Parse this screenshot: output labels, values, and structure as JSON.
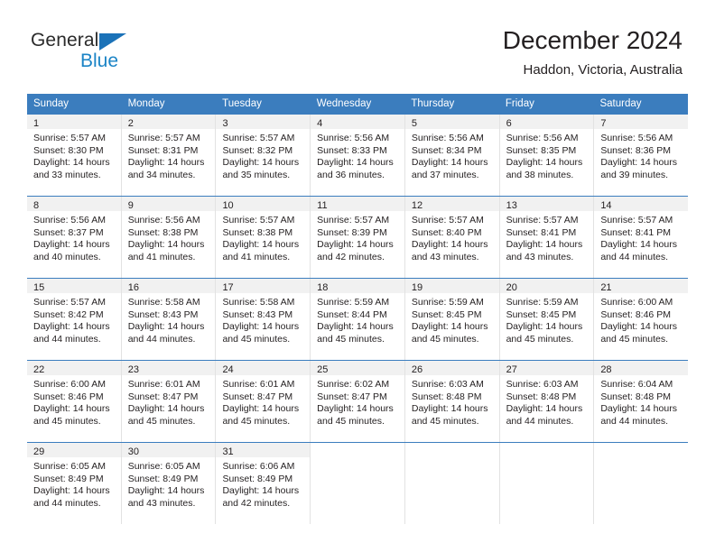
{
  "brand": {
    "name_top": "General",
    "name_bottom": "Blue",
    "triangle_color": "#1b72b8",
    "blue_text_color": "#1b84c6"
  },
  "header": {
    "title": "December 2024",
    "subtitle": "Haddon, Victoria, Australia"
  },
  "theme": {
    "header_blue": "#3b7dbe",
    "daynum_background": "#f1f1f1",
    "text_color": "#231f20",
    "cell_divider": "#e2e2e2"
  },
  "weekdays": [
    "Sunday",
    "Monday",
    "Tuesday",
    "Wednesday",
    "Thursday",
    "Friday",
    "Saturday"
  ],
  "weeks": [
    [
      {
        "day": "1",
        "sunrise": "Sunrise: 5:57 AM",
        "sunset": "Sunset: 8:30 PM",
        "daylight1": "Daylight: 14 hours",
        "daylight2": "and 33 minutes."
      },
      {
        "day": "2",
        "sunrise": "Sunrise: 5:57 AM",
        "sunset": "Sunset: 8:31 PM",
        "daylight1": "Daylight: 14 hours",
        "daylight2": "and 34 minutes."
      },
      {
        "day": "3",
        "sunrise": "Sunrise: 5:57 AM",
        "sunset": "Sunset: 8:32 PM",
        "daylight1": "Daylight: 14 hours",
        "daylight2": "and 35 minutes."
      },
      {
        "day": "4",
        "sunrise": "Sunrise: 5:56 AM",
        "sunset": "Sunset: 8:33 PM",
        "daylight1": "Daylight: 14 hours",
        "daylight2": "and 36 minutes."
      },
      {
        "day": "5",
        "sunrise": "Sunrise: 5:56 AM",
        "sunset": "Sunset: 8:34 PM",
        "daylight1": "Daylight: 14 hours",
        "daylight2": "and 37 minutes."
      },
      {
        "day": "6",
        "sunrise": "Sunrise: 5:56 AM",
        "sunset": "Sunset: 8:35 PM",
        "daylight1": "Daylight: 14 hours",
        "daylight2": "and 38 minutes."
      },
      {
        "day": "7",
        "sunrise": "Sunrise: 5:56 AM",
        "sunset": "Sunset: 8:36 PM",
        "daylight1": "Daylight: 14 hours",
        "daylight2": "and 39 minutes."
      }
    ],
    [
      {
        "day": "8",
        "sunrise": "Sunrise: 5:56 AM",
        "sunset": "Sunset: 8:37 PM",
        "daylight1": "Daylight: 14 hours",
        "daylight2": "and 40 minutes."
      },
      {
        "day": "9",
        "sunrise": "Sunrise: 5:56 AM",
        "sunset": "Sunset: 8:38 PM",
        "daylight1": "Daylight: 14 hours",
        "daylight2": "and 41 minutes."
      },
      {
        "day": "10",
        "sunrise": "Sunrise: 5:57 AM",
        "sunset": "Sunset: 8:38 PM",
        "daylight1": "Daylight: 14 hours",
        "daylight2": "and 41 minutes."
      },
      {
        "day": "11",
        "sunrise": "Sunrise: 5:57 AM",
        "sunset": "Sunset: 8:39 PM",
        "daylight1": "Daylight: 14 hours",
        "daylight2": "and 42 minutes."
      },
      {
        "day": "12",
        "sunrise": "Sunrise: 5:57 AM",
        "sunset": "Sunset: 8:40 PM",
        "daylight1": "Daylight: 14 hours",
        "daylight2": "and 43 minutes."
      },
      {
        "day": "13",
        "sunrise": "Sunrise: 5:57 AM",
        "sunset": "Sunset: 8:41 PM",
        "daylight1": "Daylight: 14 hours",
        "daylight2": "and 43 minutes."
      },
      {
        "day": "14",
        "sunrise": "Sunrise: 5:57 AM",
        "sunset": "Sunset: 8:41 PM",
        "daylight1": "Daylight: 14 hours",
        "daylight2": "and 44 minutes."
      }
    ],
    [
      {
        "day": "15",
        "sunrise": "Sunrise: 5:57 AM",
        "sunset": "Sunset: 8:42 PM",
        "daylight1": "Daylight: 14 hours",
        "daylight2": "and 44 minutes."
      },
      {
        "day": "16",
        "sunrise": "Sunrise: 5:58 AM",
        "sunset": "Sunset: 8:43 PM",
        "daylight1": "Daylight: 14 hours",
        "daylight2": "and 44 minutes."
      },
      {
        "day": "17",
        "sunrise": "Sunrise: 5:58 AM",
        "sunset": "Sunset: 8:43 PM",
        "daylight1": "Daylight: 14 hours",
        "daylight2": "and 45 minutes."
      },
      {
        "day": "18",
        "sunrise": "Sunrise: 5:59 AM",
        "sunset": "Sunset: 8:44 PM",
        "daylight1": "Daylight: 14 hours",
        "daylight2": "and 45 minutes."
      },
      {
        "day": "19",
        "sunrise": "Sunrise: 5:59 AM",
        "sunset": "Sunset: 8:45 PM",
        "daylight1": "Daylight: 14 hours",
        "daylight2": "and 45 minutes."
      },
      {
        "day": "20",
        "sunrise": "Sunrise: 5:59 AM",
        "sunset": "Sunset: 8:45 PM",
        "daylight1": "Daylight: 14 hours",
        "daylight2": "and 45 minutes."
      },
      {
        "day": "21",
        "sunrise": "Sunrise: 6:00 AM",
        "sunset": "Sunset: 8:46 PM",
        "daylight1": "Daylight: 14 hours",
        "daylight2": "and 45 minutes."
      }
    ],
    [
      {
        "day": "22",
        "sunrise": "Sunrise: 6:00 AM",
        "sunset": "Sunset: 8:46 PM",
        "daylight1": "Daylight: 14 hours",
        "daylight2": "and 45 minutes."
      },
      {
        "day": "23",
        "sunrise": "Sunrise: 6:01 AM",
        "sunset": "Sunset: 8:47 PM",
        "daylight1": "Daylight: 14 hours",
        "daylight2": "and 45 minutes."
      },
      {
        "day": "24",
        "sunrise": "Sunrise: 6:01 AM",
        "sunset": "Sunset: 8:47 PM",
        "daylight1": "Daylight: 14 hours",
        "daylight2": "and 45 minutes."
      },
      {
        "day": "25",
        "sunrise": "Sunrise: 6:02 AM",
        "sunset": "Sunset: 8:47 PM",
        "daylight1": "Daylight: 14 hours",
        "daylight2": "and 45 minutes."
      },
      {
        "day": "26",
        "sunrise": "Sunrise: 6:03 AM",
        "sunset": "Sunset: 8:48 PM",
        "daylight1": "Daylight: 14 hours",
        "daylight2": "and 45 minutes."
      },
      {
        "day": "27",
        "sunrise": "Sunrise: 6:03 AM",
        "sunset": "Sunset: 8:48 PM",
        "daylight1": "Daylight: 14 hours",
        "daylight2": "and 44 minutes."
      },
      {
        "day": "28",
        "sunrise": "Sunrise: 6:04 AM",
        "sunset": "Sunset: 8:48 PM",
        "daylight1": "Daylight: 14 hours",
        "daylight2": "and 44 minutes."
      }
    ],
    [
      {
        "day": "29",
        "sunrise": "Sunrise: 6:05 AM",
        "sunset": "Sunset: 8:49 PM",
        "daylight1": "Daylight: 14 hours",
        "daylight2": "and 44 minutes."
      },
      {
        "day": "30",
        "sunrise": "Sunrise: 6:05 AM",
        "sunset": "Sunset: 8:49 PM",
        "daylight1": "Daylight: 14 hours",
        "daylight2": "and 43 minutes."
      },
      {
        "day": "31",
        "sunrise": "Sunrise: 6:06 AM",
        "sunset": "Sunset: 8:49 PM",
        "daylight1": "Daylight: 14 hours",
        "daylight2": "and 42 minutes."
      },
      {
        "day": "",
        "sunrise": "",
        "sunset": "",
        "daylight1": "",
        "daylight2": ""
      },
      {
        "day": "",
        "sunrise": "",
        "sunset": "",
        "daylight1": "",
        "daylight2": ""
      },
      {
        "day": "",
        "sunrise": "",
        "sunset": "",
        "daylight1": "",
        "daylight2": ""
      },
      {
        "day": "",
        "sunrise": "",
        "sunset": "",
        "daylight1": "",
        "daylight2": ""
      }
    ]
  ]
}
